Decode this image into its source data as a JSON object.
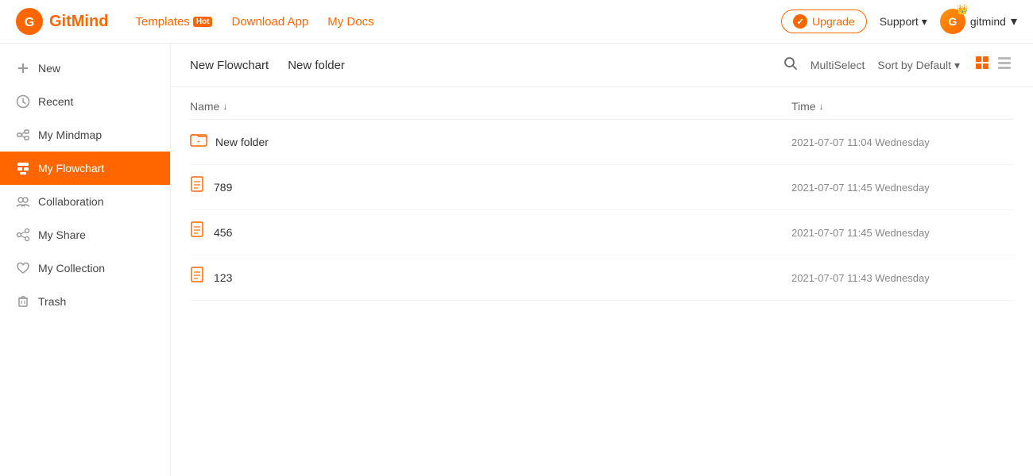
{
  "header": {
    "logo_text": "GitMind",
    "nav": [
      {
        "label": "Templates",
        "badge": "Hot"
      },
      {
        "label": "Download App"
      },
      {
        "label": "My Docs"
      }
    ],
    "upgrade_label": "Upgrade",
    "support_label": "Support",
    "user_name": "gitmind"
  },
  "sidebar": {
    "items": [
      {
        "id": "new",
        "label": "New",
        "icon": "plus"
      },
      {
        "id": "recent",
        "label": "Recent",
        "icon": "clock"
      },
      {
        "id": "mindmap",
        "label": "My Mindmap",
        "icon": "mindmap"
      },
      {
        "id": "flowchart",
        "label": "My Flowchart",
        "icon": "flowchart",
        "active": true
      },
      {
        "id": "collaboration",
        "label": "Collaboration",
        "icon": "collab"
      },
      {
        "id": "myshare",
        "label": "My Share",
        "icon": "share"
      },
      {
        "id": "mycollection",
        "label": "My Collection",
        "icon": "heart"
      },
      {
        "id": "trash",
        "label": "Trash",
        "icon": "trash"
      }
    ]
  },
  "toolbar": {
    "new_flowchart_label": "New Flowchart",
    "new_folder_label": "New folder",
    "multiselect_label": "MultiSelect",
    "sort_label": "Sort by Default"
  },
  "file_list": {
    "col_name": "Name",
    "col_time": "Time",
    "files": [
      {
        "id": 1,
        "name": "New folder",
        "type": "folder",
        "time": "2021-07-07 11:04 Wednesday"
      },
      {
        "id": 2,
        "name": "789",
        "type": "doc",
        "time": "2021-07-07 11:45 Wednesday"
      },
      {
        "id": 3,
        "name": "456",
        "type": "doc",
        "time": "2021-07-07 11:45 Wednesday"
      },
      {
        "id": 4,
        "name": "123",
        "type": "doc",
        "time": "2021-07-07 11:43 Wednesday"
      }
    ]
  }
}
